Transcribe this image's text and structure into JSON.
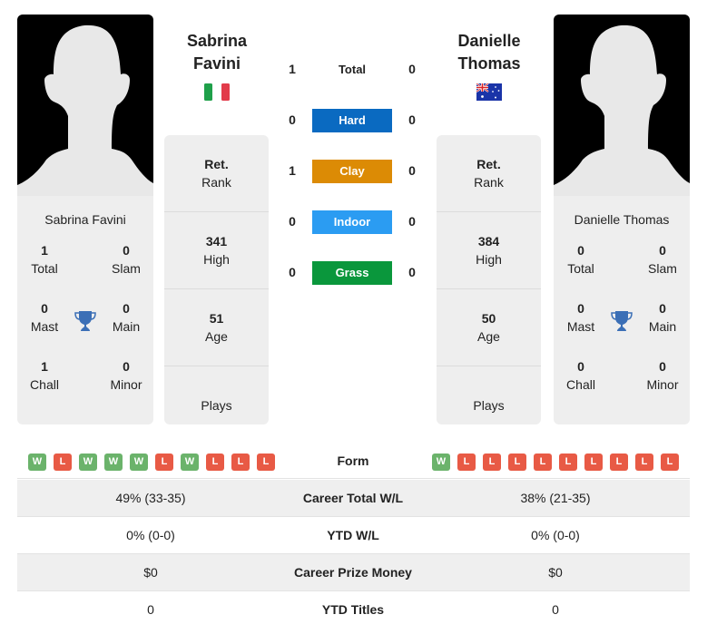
{
  "player1": {
    "name": "Sabrina Favini",
    "name_line1": "Sabrina",
    "name_line2": "Favini",
    "flag": "italy-flag",
    "rank_value": "Ret.",
    "rank_label": "Rank",
    "high_value": "341",
    "high_label": "High",
    "age_value": "51",
    "age_label": "Age",
    "plays_label": "Plays",
    "titles": {
      "total": "1",
      "total_label": "Total",
      "slam": "0",
      "slam_label": "Slam",
      "mast": "0",
      "mast_label": "Mast",
      "main": "0",
      "main_label": "Main",
      "chall": "1",
      "chall_label": "Chall",
      "minor": "0",
      "minor_label": "Minor"
    },
    "form": [
      "W",
      "L",
      "W",
      "W",
      "W",
      "L",
      "W",
      "L",
      "L",
      "L"
    ]
  },
  "player2": {
    "name": "Danielle Thomas",
    "name_line1": "Danielle",
    "name_line2": "Thomas",
    "flag": "australia-flag",
    "rank_value": "Ret.",
    "rank_label": "Rank",
    "high_value": "384",
    "high_label": "High",
    "age_value": "50",
    "age_label": "Age",
    "plays_label": "Plays",
    "titles": {
      "total": "0",
      "total_label": "Total",
      "slam": "0",
      "slam_label": "Slam",
      "mast": "0",
      "mast_label": "Mast",
      "main": "0",
      "main_label": "Main",
      "chall": "0",
      "chall_label": "Chall",
      "minor": "0",
      "minor_label": "Minor"
    },
    "form": [
      "W",
      "L",
      "L",
      "L",
      "L",
      "L",
      "L",
      "L",
      "L",
      "L"
    ]
  },
  "h2h": [
    {
      "label": "Total",
      "left": "1",
      "right": "0",
      "color": ""
    },
    {
      "label": "Hard",
      "left": "0",
      "right": "0",
      "color": "#0a6ac1"
    },
    {
      "label": "Clay",
      "left": "1",
      "right": "0",
      "color": "#dc8b05"
    },
    {
      "label": "Indoor",
      "left": "0",
      "right": "0",
      "color": "#2b9cf2"
    },
    {
      "label": "Grass",
      "left": "0",
      "right": "0",
      "color": "#0a973c"
    }
  ],
  "form_label": "Form",
  "stats": [
    {
      "label": "Career Total W/L",
      "left": "49% (33-35)",
      "right": "38% (21-35)"
    },
    {
      "label": "YTD W/L",
      "left": "0% (0-0)",
      "right": "0% (0-0)"
    },
    {
      "label": "Career Prize Money",
      "left": "$0",
      "right": "$0"
    },
    {
      "label": "YTD Titles",
      "left": "0",
      "right": "0"
    }
  ]
}
